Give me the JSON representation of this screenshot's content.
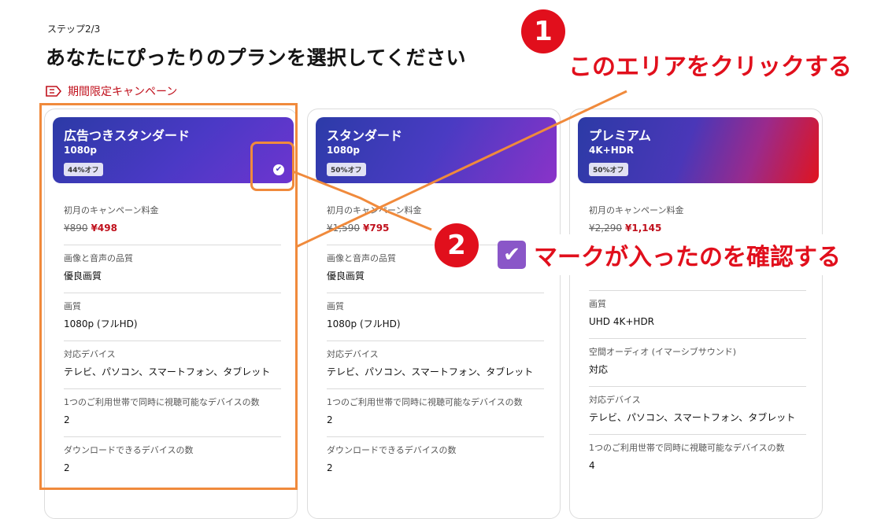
{
  "header": {
    "step": "ステップ2/3",
    "title": "あなたにぴったりのプランを選択してください",
    "promo": "期間限定キャンペーン"
  },
  "plans": [
    {
      "name": "広告つきスタンダード",
      "resolution": "1080p",
      "badge": "44%オフ",
      "selected": true,
      "rows": [
        {
          "label": "初月のキャンペーン料金",
          "old_price": "¥890",
          "new_price": "¥498"
        },
        {
          "label": "画像と音声の品質",
          "value": "優良画質"
        },
        {
          "label": "画質",
          "value": "1080p (フルHD)"
        },
        {
          "label": "対応デバイス",
          "value": "テレビ、パソコン、スマートフォン、タブレット"
        },
        {
          "label": "1つのご利用世帯で同時に視聴可能なデバイスの数",
          "value": "2"
        },
        {
          "label": "ダウンロードできるデバイスの数",
          "value": "2"
        }
      ]
    },
    {
      "name": "スタンダード",
      "resolution": "1080p",
      "badge": "50%オフ",
      "selected": false,
      "rows": [
        {
          "label": "初月のキャンペーン料金",
          "old_price": "¥1,590",
          "new_price": "¥795"
        },
        {
          "label": "画像と音声の品質",
          "value": "優良画質"
        },
        {
          "label": "画質",
          "value": "1080p (フルHD)"
        },
        {
          "label": "対応デバイス",
          "value": "テレビ、パソコン、スマートフォン、タブレット"
        },
        {
          "label": "1つのご利用世帯で同時に視聴可能なデバイスの数",
          "value": "2"
        },
        {
          "label": "ダウンロードできるデバイスの数",
          "value": "2"
        }
      ]
    },
    {
      "name": "プレミアム",
      "resolution": "4K+HDR",
      "badge": "50%オフ",
      "selected": false,
      "rows": [
        {
          "label": "初月のキャンペーン料金",
          "old_price": "¥2,290",
          "new_price": "¥1,145"
        },
        {
          "label": "",
          "value": ""
        },
        {
          "label": "画質",
          "value": "UHD 4K+HDR"
        },
        {
          "label": "空間オーディオ (イマーシブサウンド)",
          "value": "対応"
        },
        {
          "label": "対応デバイス",
          "value": "テレビ、パソコン、スマートフォン、タブレット"
        },
        {
          "label": "1つのご利用世帯で同時に視聴可能なデバイスの数",
          "value": "4"
        }
      ]
    }
  ],
  "annotations": {
    "step1_number": "1",
    "step1_text": "このエリアをクリックする",
    "step2_number": "2",
    "step2_text": "マークが入ったのを確認する",
    "check_glyph": "✔",
    "accent_color": "#e10f1c",
    "highlight_color": "#f08a3c"
  }
}
